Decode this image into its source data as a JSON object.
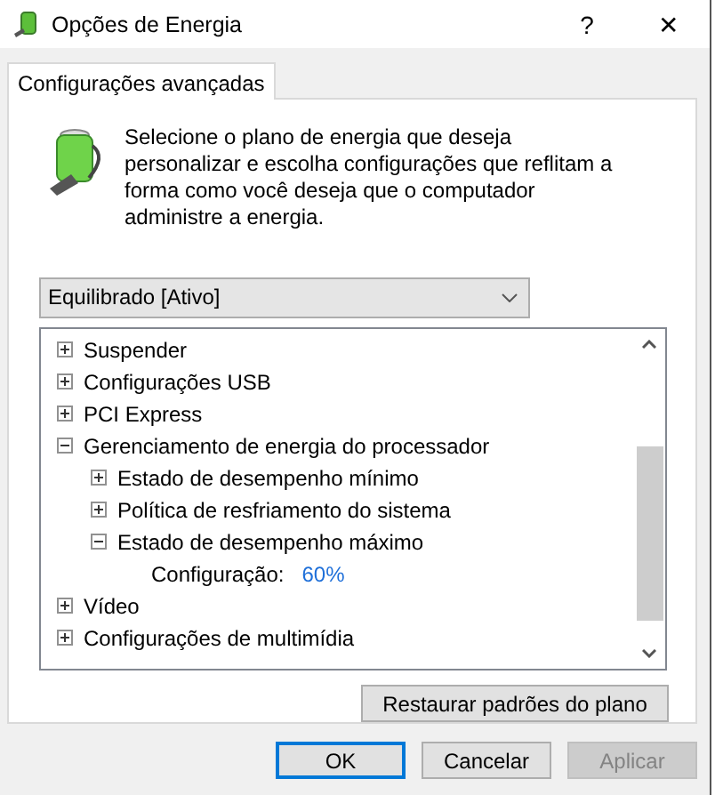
{
  "window": {
    "title": "Opções de Energia",
    "help": "?",
    "close": "✕"
  },
  "tabs": [
    {
      "label": "Configurações avançadas",
      "selected": true
    }
  ],
  "description": "Selecione o plano de energia que deseja personalizar e escolha configurações que reflitam a forma como você deseja que o computador administre a energia.",
  "plan_dropdown": {
    "value": "Equilibrado [Ativo]"
  },
  "tree": [
    {
      "kind": "group",
      "label": "Suspender",
      "expanded": false
    },
    {
      "kind": "group",
      "label": "Configurações USB",
      "expanded": false
    },
    {
      "kind": "group",
      "label": "PCI Express",
      "expanded": false
    },
    {
      "kind": "group",
      "label": "Gerenciamento de energia do processador",
      "expanded": true,
      "children": [
        {
          "kind": "group",
          "label": "Estado de desempenho mínimo",
          "expanded": false
        },
        {
          "kind": "group",
          "label": "Política de resfriamento do sistema",
          "expanded": false
        },
        {
          "kind": "group",
          "label": "Estado de desempenho máximo",
          "expanded": true,
          "children": [
            {
              "kind": "setting",
              "label": "Configuração:",
              "value": "60%"
            }
          ]
        }
      ]
    },
    {
      "kind": "group",
      "label": "Vídeo",
      "expanded": false
    },
    {
      "kind": "group",
      "label": "Configurações de multimídia",
      "expanded": false
    }
  ],
  "restore_button": "Restaurar padrões do plano",
  "buttons": [
    {
      "label": "OK",
      "default": true,
      "disabled": false
    },
    {
      "label": "Cancelar",
      "default": false,
      "disabled": false
    },
    {
      "label": "Aplicar",
      "default": false,
      "disabled": true
    }
  ]
}
